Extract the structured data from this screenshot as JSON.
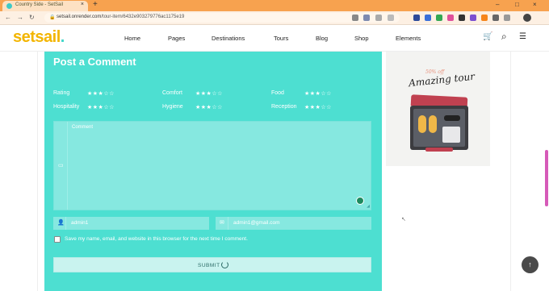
{
  "browser": {
    "tab_title": "Country Side - SetSail",
    "tab_close": "×",
    "new_tab": "+",
    "url_host": "setsail.onrender.com",
    "url_path": "/tour-item/6432e903279776ac1175e19",
    "back": "←",
    "forward": "→",
    "reload": "↻",
    "lock": "🔒",
    "minimize": "–",
    "maximize": "□",
    "close": "×"
  },
  "header": {
    "logo": "setsail",
    "logo_dot": ".",
    "menu": [
      "Home",
      "Pages",
      "Destinations",
      "Tours",
      "Blog",
      "Shop",
      "Elements"
    ],
    "cart_icon": "🛒",
    "search_icon": "⌕",
    "hamburger_icon": "☰"
  },
  "comment_form": {
    "heading": "Post a Comment",
    "ratings": [
      {
        "label": "Rating",
        "stars": "★★★☆☆"
      },
      {
        "label": "Comfort",
        "stars": "★★★☆☆"
      },
      {
        "label": "Food",
        "stars": "★★★☆☆"
      },
      {
        "label": "Hospitality",
        "stars": "★★★☆☆"
      },
      {
        "label": "Hygiene",
        "stars": "★★★☆☆"
      },
      {
        "label": "Reception",
        "stars": "★★★☆☆"
      }
    ],
    "comment_placeholder": "Comment",
    "name_value": "admin1",
    "email_value": "admin1@gmail.com",
    "save_info_label": "Save my name, email, and website in this browser for the next time I comment.",
    "submit_label": "SUBMIT",
    "comment_icon": "▭",
    "user_icon": "👤",
    "email_icon": "✉"
  },
  "ad": {
    "offer": "50% off",
    "title": "Amazing tour"
  },
  "scroll_top": {
    "icon": "↑"
  },
  "colors": {
    "accent_teal": "#4ddfd1",
    "logo_yellow": "#f3b500",
    "browser_orange": "#f7a24f"
  }
}
